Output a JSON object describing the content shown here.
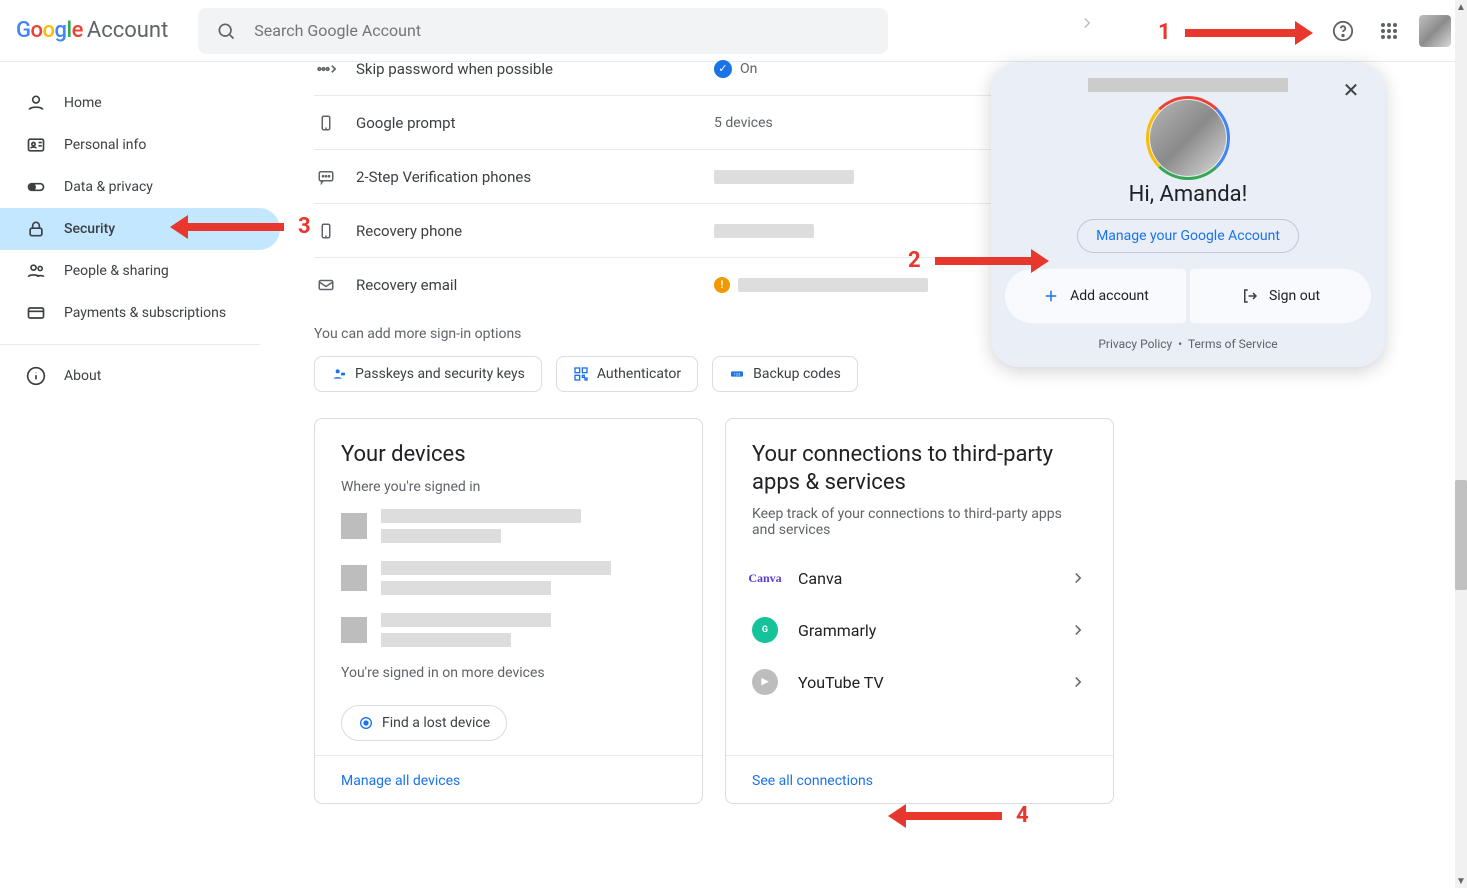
{
  "header": {
    "logo_brand": "Google",
    "logo_product": "Account",
    "search_placeholder": "Search Google Account"
  },
  "sidebar": {
    "items": [
      {
        "label": "Home",
        "icon": "home"
      },
      {
        "label": "Personal info",
        "icon": "idcard"
      },
      {
        "label": "Data & privacy",
        "icon": "toggle"
      },
      {
        "label": "Security",
        "icon": "lock",
        "active": true
      },
      {
        "label": "People & sharing",
        "icon": "people"
      },
      {
        "label": "Payments & subscriptions",
        "icon": "card"
      }
    ],
    "about": "About"
  },
  "security_rows": [
    {
      "icon": "skip",
      "label": "Skip password when possible",
      "value": "On",
      "status": "check"
    },
    {
      "icon": "phone",
      "label": "Google prompt",
      "value": "5 devices",
      "status": "none"
    },
    {
      "icon": "sms",
      "label": "2-Step Verification phones",
      "value": "",
      "status": "redact"
    },
    {
      "icon": "device",
      "label": "Recovery phone",
      "value": "",
      "status": "redact"
    },
    {
      "icon": "mail",
      "label": "Recovery email",
      "value": "",
      "status": "warn-redact"
    }
  ],
  "signin_hint": "You can add more sign-in options",
  "signin_chips": [
    {
      "label": "Passkeys and security keys",
      "icon": "passkey"
    },
    {
      "label": "Authenticator",
      "icon": "qr"
    },
    {
      "label": "Backup codes",
      "icon": "codes"
    }
  ],
  "devices_card": {
    "title": "Your devices",
    "subtitle": "Where you're signed in",
    "more": "You're signed in on more devices",
    "find": "Find a lost device",
    "footer": "Manage all devices"
  },
  "connections_card": {
    "title": "Your connections to third-party apps & services",
    "subtitle": "Keep track of your connections to third-party apps and services",
    "items": [
      {
        "label": "Canva",
        "icon": "canva"
      },
      {
        "label": "Grammarly",
        "icon": "grammarly"
      },
      {
        "label": "YouTube TV",
        "icon": "yttv"
      }
    ],
    "footer": "See all connections"
  },
  "popover": {
    "greeting": "Hi, Amanda!",
    "manage": "Manage your Google Account",
    "add": "Add account",
    "signout": "Sign out",
    "privacy": "Privacy Policy",
    "tos": "Terms of Service"
  },
  "annotations": {
    "a1": "1",
    "a2": "2",
    "a3": "3",
    "a4": "4"
  }
}
